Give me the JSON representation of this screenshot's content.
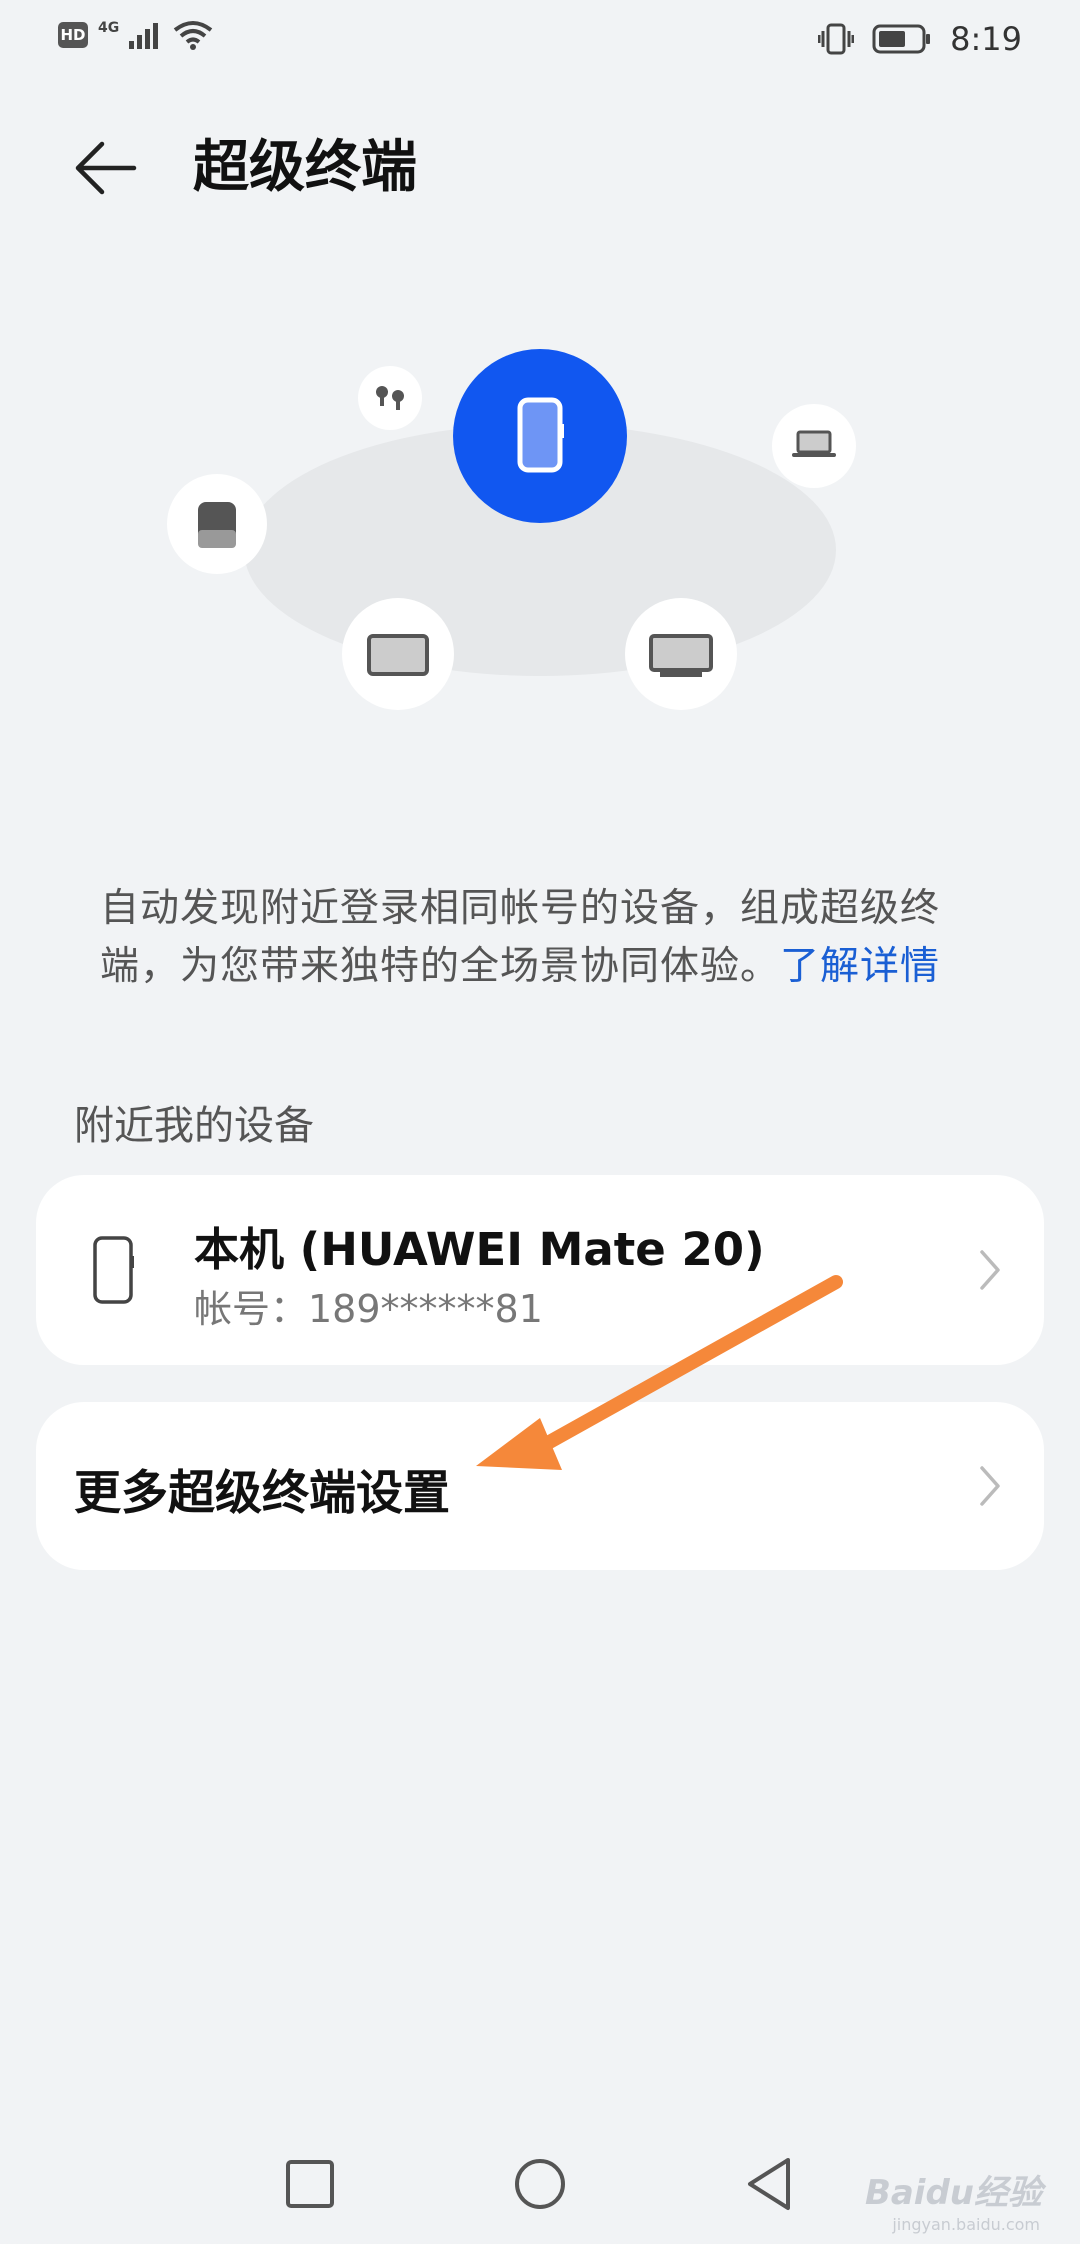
{
  "status_bar": {
    "hd": "HD",
    "network": "4G",
    "time": "8:19"
  },
  "header": {
    "back_icon": "arrow-left-icon",
    "title": "超级终端"
  },
  "description": {
    "text": "自动发现附近登录相同帐号的设备，组成超级终端，为您带来独特的全场景协同体验。",
    "link": "了解详情"
  },
  "section": {
    "label": "附近我的设备"
  },
  "device": {
    "name": "本机 (HUAWEI Mate 20)",
    "account": "帐号：189******81",
    "icon": "phone-icon"
  },
  "settings": {
    "label": "更多超级终端设置"
  },
  "illustration_devices": [
    "earbuds-icon",
    "phone-icon",
    "laptop-icon",
    "speaker-icon",
    "tablet-icon",
    "tv-icon"
  ],
  "colors": {
    "accent": "#1157f0",
    "link": "#1a5fd4",
    "annotation_arrow": "#f5883a",
    "background": "#f1f3f5"
  },
  "watermark": {
    "brand": "Baidu经验",
    "url": "jingyan.baidu.com"
  }
}
